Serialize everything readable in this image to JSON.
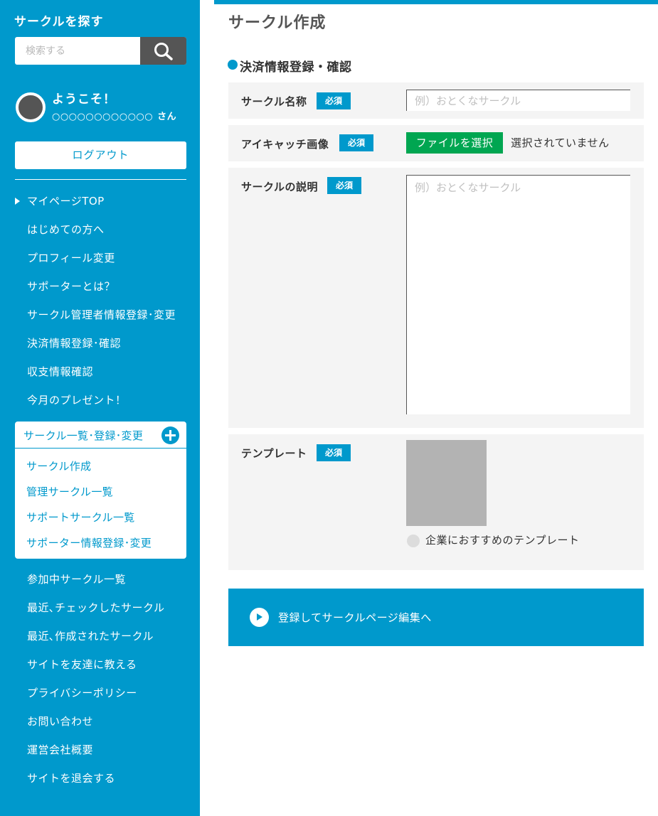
{
  "sidebar": {
    "title": "サークルを探す",
    "search": {
      "placeholder": "検索する",
      "value": ""
    },
    "user": {
      "welcome": "ようこそ！",
      "name": "○○○○○○○○○○○○",
      "suffix": "さん"
    },
    "logout_label": "ログアウト",
    "nav_top": [
      "マイページTOP",
      "はじめての方へ",
      "プロフィール変更",
      "サポーターとは？",
      "サークル管理者情報登録･変更",
      "決済情報登録･確認",
      "収支情報確認",
      "今月のプレゼント！"
    ],
    "circle_menu": {
      "header": "サークル一覧･登録･変更",
      "items": [
        "サークル作成",
        "管理サークル一覧",
        "サポートサークル一覧",
        "サポーター情報登録･変更"
      ]
    },
    "nav_bottom": [
      "参加中サークル一覧",
      "最近､チェックしたサークル",
      "最近､作成されたサークル",
      "サイトを友達に教える",
      "プライバシーポリシー",
      "お問い合わせ",
      "運営会社概要",
      "サイトを退会する"
    ]
  },
  "main": {
    "title": "サークル作成",
    "section_title": "決済情報登録・確認",
    "required_label": "必須",
    "form": {
      "name": {
        "label": "サークル名称",
        "placeholder": "例）おとくなサークル",
        "value": ""
      },
      "image": {
        "label": "アイキャッチ画像",
        "button": "ファイルを選択",
        "status": "選択されていません"
      },
      "description": {
        "label": "サークルの説明",
        "placeholder": "例）おとくなサークル",
        "value": ""
      },
      "template": {
        "label": "テンプレート",
        "option_label": "企業におすすめのテンプレート"
      }
    },
    "submit_label": "登録してサークルページ編集へ"
  },
  "colors": {
    "primary": "#0099cc",
    "file_button": "#00a651",
    "search_button": "#555555",
    "form_row_bg": "#f4f4f4",
    "thumbnail": "#b3b3b3"
  },
  "icons": [
    "search-icon",
    "avatar",
    "triangle-right-icon",
    "plus-circle-icon",
    "play-circle-icon",
    "radio-icon"
  ]
}
